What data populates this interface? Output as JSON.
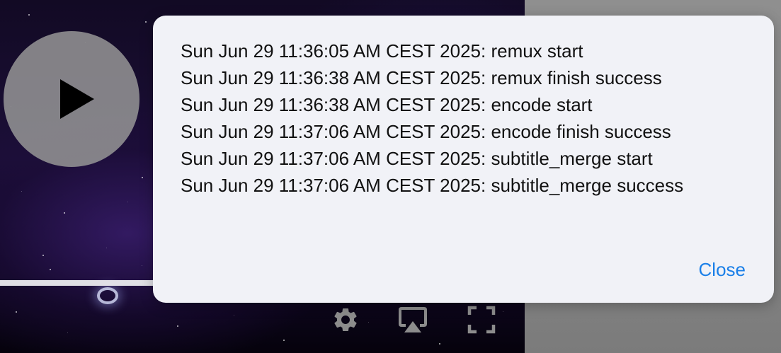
{
  "dialog": {
    "log_lines": [
      "Sun Jun 29 11:36:05 AM CEST 2025: remux start",
      "Sun Jun 29 11:36:38 AM CEST 2025: remux finish success",
      "Sun Jun 29 11:36:38 AM CEST 2025: encode start",
      "Sun Jun 29 11:37:06 AM CEST 2025: encode finish success",
      "Sun Jun 29 11:37:06 AM CEST 2025: subtitle_merge start",
      "Sun Jun 29 11:37:06 AM CEST 2025: subtitle_merge success"
    ],
    "close_label": "Close",
    "close_color": "#1a7fe8",
    "background": "#f1f2f7"
  },
  "player": {
    "play_icon": "play-icon",
    "progress_fraction": 0.3,
    "controls": [
      {
        "icon": "gear-icon"
      },
      {
        "icon": "airplay-icon"
      },
      {
        "icon": "fullscreen-icon"
      }
    ]
  }
}
